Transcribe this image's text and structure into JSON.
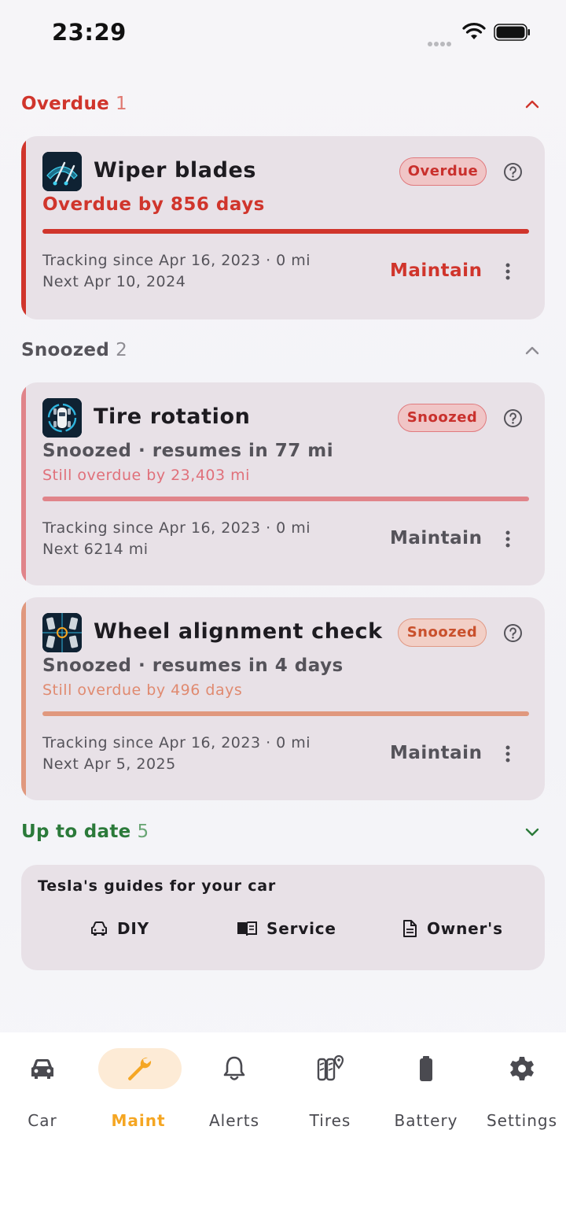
{
  "status_bar": {
    "time": "23:29"
  },
  "sections": {
    "overdue": {
      "title": "Overdue",
      "count": "1",
      "color": "#d0352c"
    },
    "snoozed": {
      "title": "Snoozed",
      "count": "2",
      "color": "#55535a"
    },
    "uptodate": {
      "title": "Up to date",
      "count": "5",
      "color": "#2b7a3a"
    }
  },
  "items": [
    {
      "title": "Wiper blades",
      "badge": "Overdue",
      "status": "Overdue by 856 days",
      "note": "",
      "tracking": "Tracking since Apr 16, 2023 · 0 mi",
      "next": "Next Apr 10, 2024",
      "action": "Maintain",
      "icon": "wiper-icon",
      "accent": "#d0352c"
    },
    {
      "title": "Tire rotation",
      "badge": "Snoozed",
      "status": "Snoozed · resumes in 77 mi",
      "note": "Still overdue by 23,403 mi",
      "tracking": "Tracking since Apr 16, 2023 · 0 mi",
      "next": "Next 6214 mi",
      "action": "Maintain",
      "icon": "tire-rotation-icon",
      "accent": "#e0848a"
    },
    {
      "title": "Wheel alignment check",
      "badge": "Snoozed",
      "status": "Snoozed · resumes in 4 days",
      "note": "Still overdue by 496 days",
      "tracking": "Tracking since Apr 16, 2023 · 0 mi",
      "next": "Next Apr 5, 2025",
      "action": "Maintain",
      "icon": "wheel-alignment-icon",
      "accent": "#e0987e"
    }
  ],
  "guides": {
    "title": "Tesla's guides for your car",
    "diy": "DIY",
    "service": "Service",
    "owners": "Owner's"
  },
  "nav": [
    {
      "label": "Car",
      "icon": "car-icon"
    },
    {
      "label": "Maint",
      "icon": "wrench-icon",
      "active": true
    },
    {
      "label": "Alerts",
      "icon": "bell-icon"
    },
    {
      "label": "Tires",
      "icon": "tires-icon"
    },
    {
      "label": "Battery",
      "icon": "battery-icon"
    },
    {
      "label": "Settings",
      "icon": "gear-icon"
    }
  ],
  "colors": {
    "active": "#f5a623",
    "active_pill": "#fdebd6",
    "card": "#e8e1e7"
  }
}
